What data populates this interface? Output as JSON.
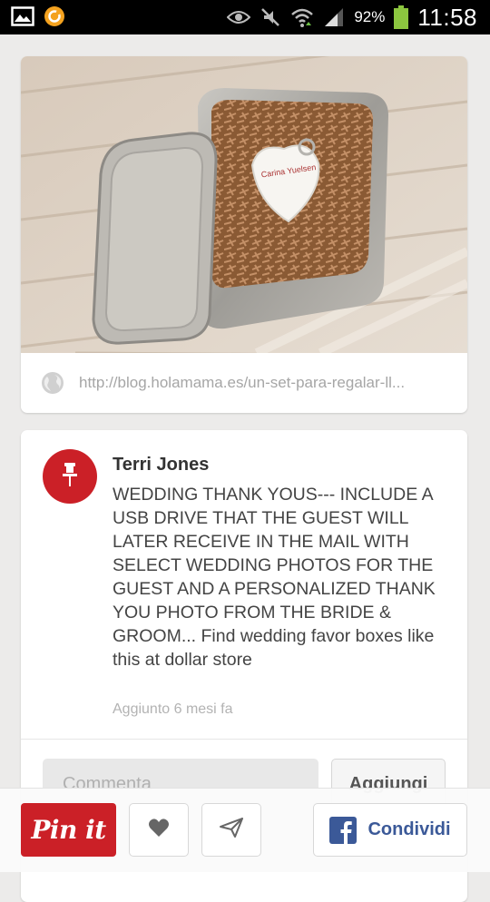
{
  "status_bar": {
    "battery_percent": "92%",
    "time": "11:58",
    "icons": [
      "gallery-icon",
      "app-notification-icon",
      "eye-icon",
      "mute-icon",
      "wifi-icon",
      "signal-icon",
      "battery-icon"
    ]
  },
  "pin": {
    "image_icon": "photo-tin-box-usb-heart",
    "source_url": "http://blog.holamama.es/un-set-para-regalar-ll...",
    "pinner_name": "Terri Jones",
    "description": "WEDDING THANK YOUS--- INCLUDE A USB DRIVE THAT THE GUEST WILL LATER RECEIVE IN THE MAIL WITH SELECT WEDDING PHOTOS FOR THE GUEST AND A PERSONALIZED THANK YOU PHOTO FROM THE BRIDE & GROOM... Find wedding favor boxes like this at dollar store",
    "added_time": "Aggiunto 6 mesi fa"
  },
  "comment": {
    "placeholder": "Commenta",
    "add_label": "Aggiungi"
  },
  "action_bar": {
    "pinit_label": "Pin it",
    "share_label": "Condividi"
  },
  "colors": {
    "pinterest_red": "#cb2027",
    "facebook_blue": "#3b5998",
    "background": "#ecebea"
  }
}
